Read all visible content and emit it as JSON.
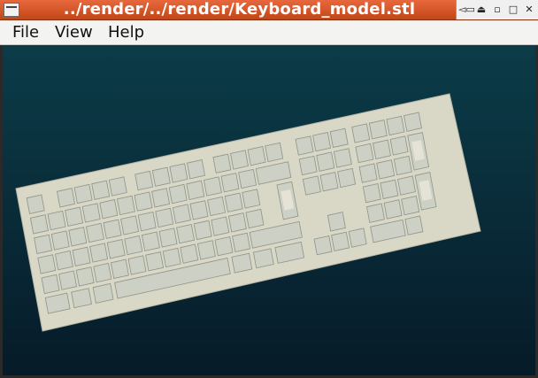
{
  "window": {
    "title": "../render/../render/Keyboard_model.stl"
  },
  "menubar": {
    "file_label": "File",
    "view_label": "View",
    "help_label": "Help"
  },
  "window_buttons": {
    "roll_up": "◅▭",
    "shade": "⏏",
    "minimize": "▫",
    "maximize": "□",
    "close": "✕"
  },
  "viewport": {
    "background_top": "#0b3c48",
    "background_bottom": "#061b27",
    "model_color": "#d9d7c6",
    "model": "keyboard"
  }
}
